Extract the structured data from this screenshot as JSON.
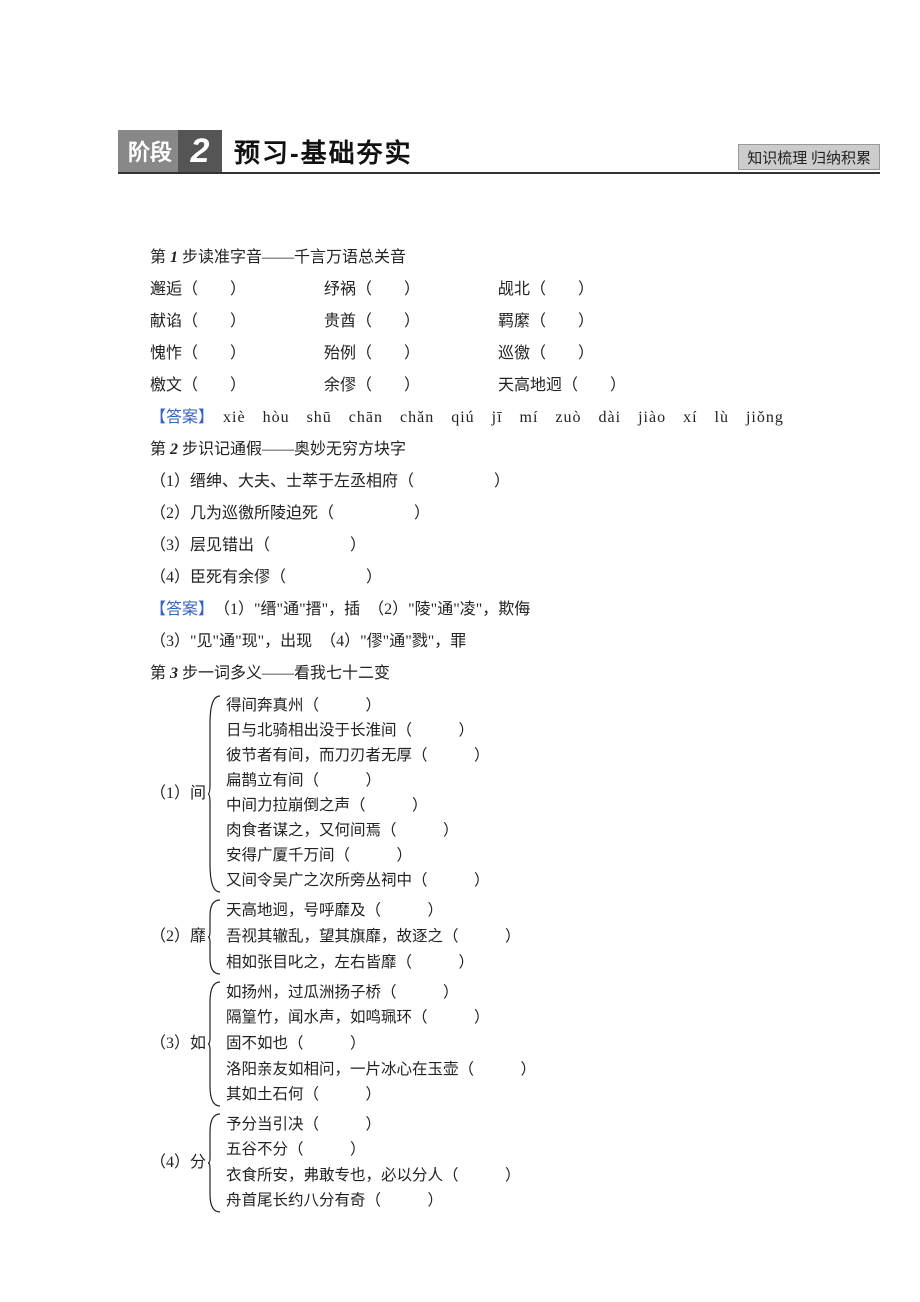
{
  "banner": {
    "stage": "阶段",
    "number": "2",
    "title": "预习-基础夯实",
    "side": "知识梳理 归纳积累"
  },
  "step1": {
    "heading_prefix": "第 ",
    "heading_num": "1",
    "heading_suffix": " 步读准字音——千言万语总关音",
    "row1": {
      "a": "邂逅（　　）",
      "b": "纾祸（　　）",
      "c": "觇北（　　）"
    },
    "row2": {
      "a": "献谄（　　）",
      "b": "贵酋（　　）",
      "c": "羁縻（　　）"
    },
    "row3": {
      "a": "愧怍（　　）",
      "b": "殆例（　　）",
      "c": "巡徼（　　）"
    },
    "row4": {
      "a": "檄文（　　）",
      "b": "余僇（　　）",
      "c": "天高地迥（　　）"
    },
    "answer_label": "【答案】",
    "answer_pinyin": "　xiè　hòu　shū　chān　chǎn　qiú　jī　mí　zuò　dài　jiào　xí　lù　jiǒng"
  },
  "step2": {
    "heading_prefix": "第 ",
    "heading_num": "2",
    "heading_suffix": " 步识记通假——奥妙无穷方块字",
    "items": [
      "（1）缙绅、大夫、士萃于左丞相府（　　　　　）",
      "（2）几为巡徼所陵迫死（　　　　　）",
      "（3）层见错出（　　　　　）",
      "（4）臣死有余僇（　　　　　）"
    ],
    "answer_label": "【答案】",
    "answer1": "　（1）\"缙\"通\"搢\"，插　（2）\"陵\"通\"凌\"，欺侮",
    "answer2": "（3）\"见\"通\"现\"，出现　（4）\"僇\"通\"戮\"，罪"
  },
  "step3": {
    "heading_prefix": "第 ",
    "heading_num": "3",
    "heading_suffix": " 步一词多义——看我七十二变",
    "g1": {
      "label": "（1）间",
      "lines": [
        "得间奔真州（　　　）",
        "日与北骑相出没于长淮间（　　　）",
        "彼节者有间，而刀刃者无厚（　　　）",
        "扁鹊立有间（　　　）",
        "中间力拉崩倒之声（　　　）",
        "肉食者谋之，又何间焉（　　　）",
        "安得广厦千万间（　　　）",
        "又间令吴广之次所旁丛祠中（　　　）"
      ]
    },
    "g2": {
      "label": "（2）靡",
      "lines": [
        "天高地迥，号呼靡及（　　　）",
        "吾视其辙乱，望其旗靡，故逐之（　　　）",
        "相如张目叱之，左右皆靡（　　　）"
      ]
    },
    "g3": {
      "label": "（3）如",
      "lines": [
        "如扬州，过瓜洲扬子桥（　　　）",
        "隔篁竹，闻水声，如鸣珮环（　　　）",
        "固不如也（　　　）",
        "洛阳亲友如相问，一片冰心在玉壶（　　　）",
        "其如土石何（　　　）"
      ]
    },
    "g4": {
      "label": "（4）分",
      "lines": [
        "予分当引决（　　　）",
        "五谷不分（　　　）",
        "衣食所安，弗敢专也，必以分人（　　　）",
        "舟首尾长约八分有奇（　　　）"
      ]
    }
  }
}
